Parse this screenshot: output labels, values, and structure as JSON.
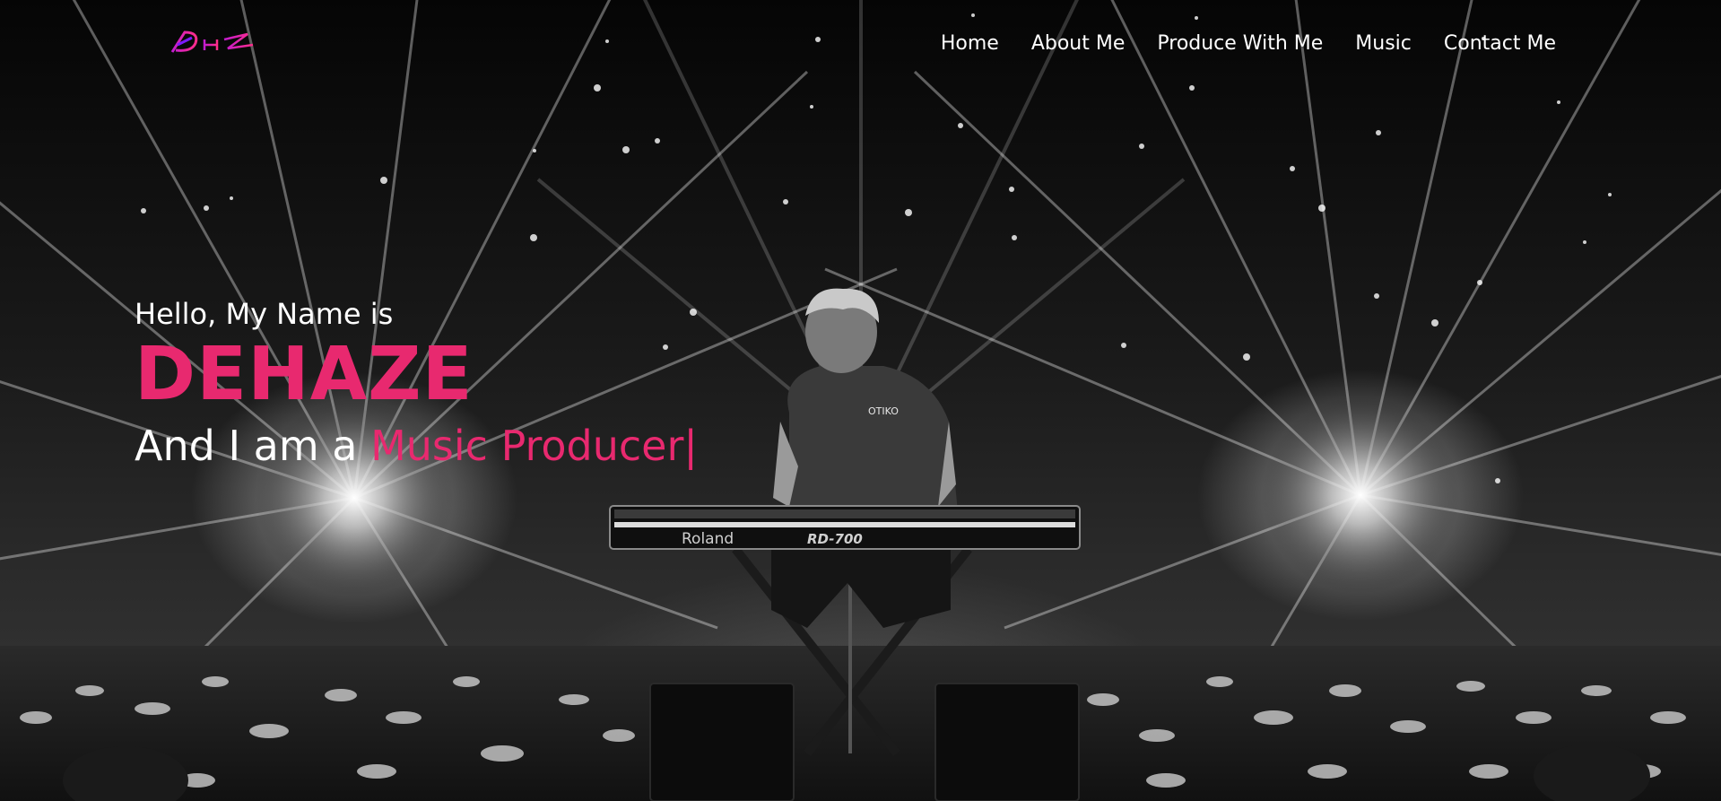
{
  "brand": {
    "logo_icon": "dhz-logo-icon",
    "accent_color": "#e8296f"
  },
  "nav": {
    "items": [
      {
        "label": "Home"
      },
      {
        "label": "About Me"
      },
      {
        "label": "Produce With Me"
      },
      {
        "label": "Music"
      },
      {
        "label": "Contact Me"
      }
    ]
  },
  "hero": {
    "greeting": "Hello, My Name is",
    "name": "DEHAZE",
    "role_prefix": "And I am a ",
    "role": "Music Producer",
    "cursor": "|",
    "keyboard_brand": "Roland",
    "keyboard_model": "RD-700",
    "shirt_text": "OTIKO"
  }
}
